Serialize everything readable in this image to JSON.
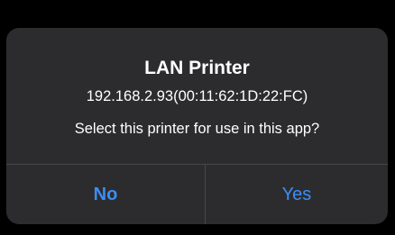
{
  "dialog": {
    "title": "LAN Printer",
    "address": "192.168.2.93(00:11:62:1D:22:FC)",
    "message": "Select this printer for use in this app?",
    "buttons": {
      "no_label": "No",
      "yes_label": "Yes"
    },
    "colors": {
      "background": "#2c2c2e",
      "text": "#ffffff",
      "button_text": "#3a8ef6",
      "divider": "#48484a"
    }
  }
}
